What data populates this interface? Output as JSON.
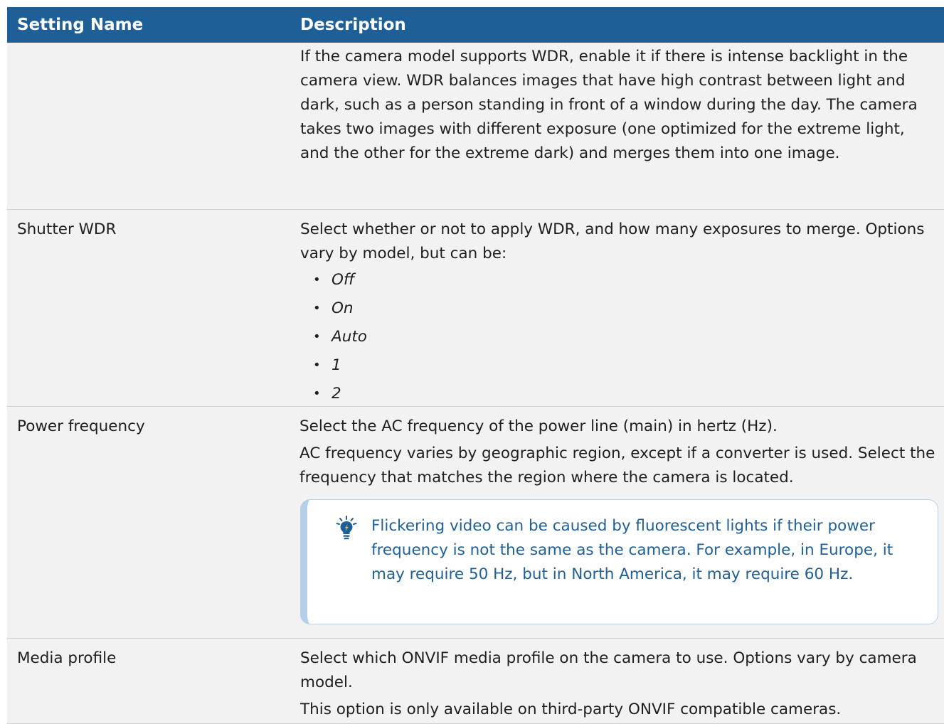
{
  "table": {
    "header": {
      "col1": "Setting Name",
      "col2": "Description"
    },
    "rows": [
      {
        "name": "",
        "desc": "If the camera model supports WDR, enable it if there is intense backlight in the camera view. WDR balances images that have high contrast between light and dark, such as a person standing in front of a window during the day. The camera takes two images with different exposure (one optimized for the extreme light, and the other for the extreme dark) and merges them into one image."
      },
      {
        "name": "Shutter WDR",
        "desc": "Select whether or not to apply WDR, and how many exposures to merge. Options vary by model, but can be:",
        "options": [
          "Off",
          "On",
          "Auto",
          "1",
          "2"
        ]
      },
      {
        "name": "Power frequency",
        "desc": "Select the AC frequency of the power line (main) in hertz (Hz).",
        "desc2": "AC frequency varies by geographic region, except if a converter is used. Select the frequency that matches the region where the camera is located.",
        "tip": "Flickering video can be caused by fluorescent lights if their power frequency is not the same as the camera. For example, in Europe, it may require 50 Hz, but in North America, it may require 60 Hz."
      },
      {
        "name": "Media profile",
        "desc": "Select which ONVIF media profile on the camera to use. Options vary by camera model.",
        "desc2": "This option is only available on third-party ONVIF compatible cameras."
      }
    ]
  },
  "colors": {
    "header_bg": "#1f5f97",
    "row_bg": "#f2f2f2",
    "tip_text": "#1f5f97",
    "tip_border": "#b6cfe9"
  },
  "icons": {
    "tip": "lightbulb-icon"
  }
}
